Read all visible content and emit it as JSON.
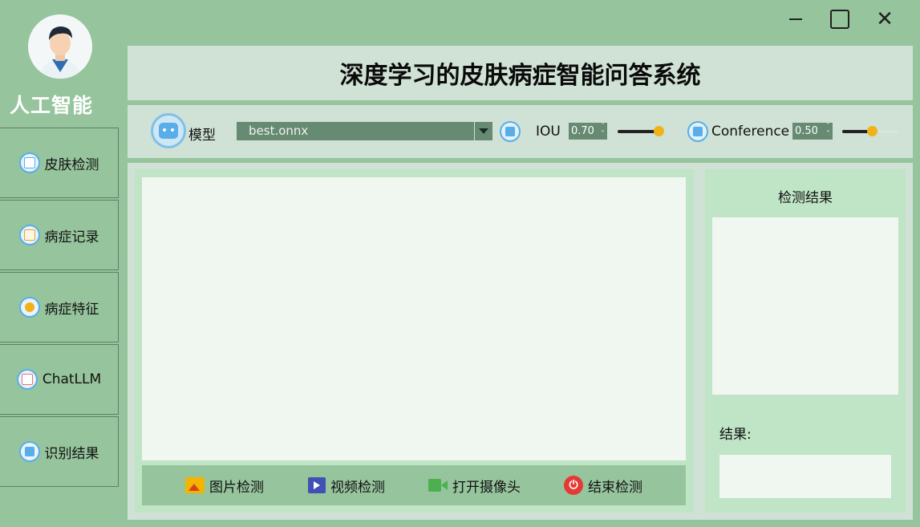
{
  "app": {
    "brand": "人工智能",
    "title": "深度学习的皮肤病症智能问答系统"
  },
  "window_controls": {
    "minimize": "minimize-icon",
    "maximize": "maximize-icon",
    "close": "close-icon"
  },
  "sidebar": {
    "items": [
      {
        "label": "皮肤检测",
        "icon": "skin-detect-icon"
      },
      {
        "label": "病症记录",
        "icon": "records-icon"
      },
      {
        "label": "病症特征",
        "icon": "features-icon"
      },
      {
        "label": "ChatLLM",
        "icon": "chat-icon"
      },
      {
        "label": "识别结果",
        "icon": "folder-icon"
      }
    ]
  },
  "toolbar": {
    "model_label": "模型",
    "model_value": "best.onnx",
    "iou_label": "IOU",
    "iou_value": "0.70",
    "iou_level": 0.7,
    "conf_label": "Conference",
    "conf_value": "0.50",
    "conf_level": 0.5
  },
  "actions": {
    "image_detect": "图片检测",
    "video_detect": "视频检测",
    "open_camera": "打开摄像头",
    "stop_detect": "结束检测"
  },
  "results": {
    "title": "检测结果",
    "result_label": "结果:"
  },
  "colors": {
    "background": "#96c49c",
    "panel": "#d0e2d5",
    "inner_panel": "#bfe4c6",
    "control": "#678a72",
    "accent": "#f1b217",
    "icon_blue": "#58aee8"
  }
}
